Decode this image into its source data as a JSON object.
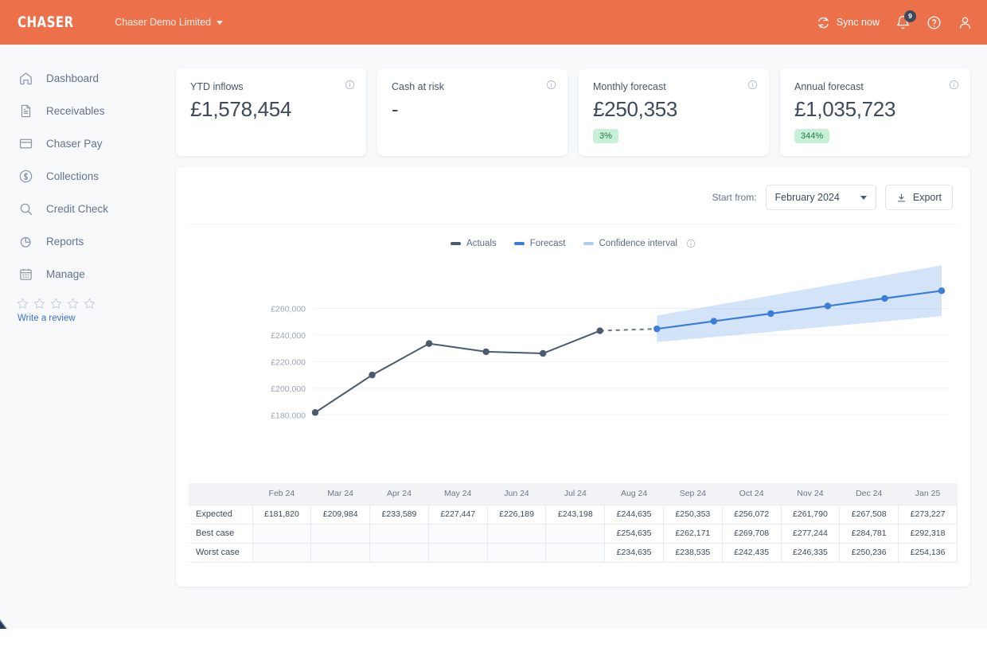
{
  "topbar": {
    "brand": "CHASER",
    "org_name": "Chaser Demo Limited",
    "sync_label": "Sync now",
    "notification_count": "9",
    "icons": {
      "sync": "sync-icon",
      "bell": "bell-icon",
      "help": "help-circle-icon",
      "account": "user-avatar-icon"
    },
    "accent_color": "#ec7049"
  },
  "sidebar": {
    "items": [
      {
        "label": "Dashboard",
        "icon": "home-icon"
      },
      {
        "label": "Receivables",
        "icon": "document-icon"
      },
      {
        "label": "Chaser Pay",
        "icon": "credit-card-icon"
      },
      {
        "label": "Collections",
        "icon": "dollar-circle-icon"
      },
      {
        "label": "Credit Check",
        "icon": "search-icon"
      },
      {
        "label": "Reports",
        "icon": "pie-chart-icon"
      },
      {
        "label": "Manage",
        "icon": "calendar-icon"
      }
    ],
    "review": {
      "stars": 5,
      "link_label": "Write a review",
      "link_color": "#3b6fd4"
    }
  },
  "kpis": [
    {
      "label": "YTD inflows",
      "value": "£1,578,454",
      "pill": null,
      "info": "info-icon"
    },
    {
      "label": "Cash at risk",
      "value": "-",
      "pill": null,
      "info": "info-icon"
    },
    {
      "label": "Monthly forecast",
      "value": "£250,353",
      "pill": "3%",
      "info": "info-icon"
    },
    {
      "label": "Annual forecast",
      "value": "£1,035,723",
      "pill": "344%",
      "info": "info-icon"
    }
  ],
  "panel": {
    "start_from_label": "Start from:",
    "start_from_value": "February 2024",
    "export_label": "Export",
    "legend_info": "info-icon",
    "legend": [
      {
        "label": "Actuals",
        "color": "#4b5a6e"
      },
      {
        "label": "Forecast",
        "color": "#3b7dd8"
      },
      {
        "label": "Confidence interval",
        "color": "#aecdf4"
      }
    ]
  },
  "chart_data": {
    "type": "line",
    "title": "",
    "xlabel": "",
    "ylabel": "",
    "grid": true,
    "legend_position": "top-center",
    "ylim": [
      170000,
      280000
    ],
    "ytick_labels": [
      "£180,000",
      "£200,000",
      "£220,000",
      "£240,000",
      "£260,000"
    ],
    "yticks": [
      180000,
      200000,
      220000,
      240000,
      260000
    ],
    "categories": [
      "Feb 24",
      "Mar 24",
      "Apr 24",
      "May 24",
      "Jun 24",
      "Jul 24",
      "Aug 24",
      "Sep 24",
      "Oct 24",
      "Nov 24",
      "Dec 24",
      "Jan 25"
    ],
    "series": [
      {
        "name": "Actuals",
        "color": "#4b5a6e",
        "values": [
          181820,
          209984,
          233589,
          227447,
          226189,
          243198,
          null,
          null,
          null,
          null,
          null,
          null
        ]
      },
      {
        "name": "Forecast",
        "color": "#3b7dd8",
        "values": [
          null,
          null,
          null,
          null,
          null,
          null,
          244635,
          250353,
          256072,
          261790,
          267508,
          273227
        ]
      },
      {
        "name": "Confidence interval upper",
        "color": "#aecdf4",
        "values": [
          null,
          null,
          null,
          null,
          null,
          null,
          254635,
          262171,
          269708,
          277244,
          284781,
          292318
        ]
      },
      {
        "name": "Confidence interval lower",
        "color": "#aecdf4",
        "values": [
          null,
          null,
          null,
          null,
          null,
          null,
          234635,
          238535,
          242435,
          246335,
          250236,
          254136
        ]
      }
    ]
  },
  "table": {
    "columns": [
      "",
      "Feb 24",
      "Mar 24",
      "Apr 24",
      "May 24",
      "Jun 24",
      "Jul 24",
      "Aug 24",
      "Sep 24",
      "Oct 24",
      "Nov 24",
      "Dec 24",
      "Jan 25"
    ],
    "rows": [
      {
        "label": "Expected",
        "cells": [
          "£181,820",
          "£209,984",
          "£233,589",
          "£227,447",
          "£226,189",
          "£243,198",
          "£244,635",
          "£250,353",
          "£256,072",
          "£261,790",
          "£267,508",
          "£273,227"
        ]
      },
      {
        "label": "Best case",
        "cells": [
          "",
          "",
          "",
          "",
          "",
          "",
          "£254,635",
          "£262,171",
          "£269,708",
          "£277,244",
          "£284,781",
          "£292,318"
        ]
      },
      {
        "label": "Worst case",
        "cells": [
          "",
          "",
          "",
          "",
          "",
          "",
          "£234,635",
          "£238,535",
          "£242,435",
          "£246,335",
          "£250,236",
          "£254,136"
        ]
      }
    ]
  }
}
